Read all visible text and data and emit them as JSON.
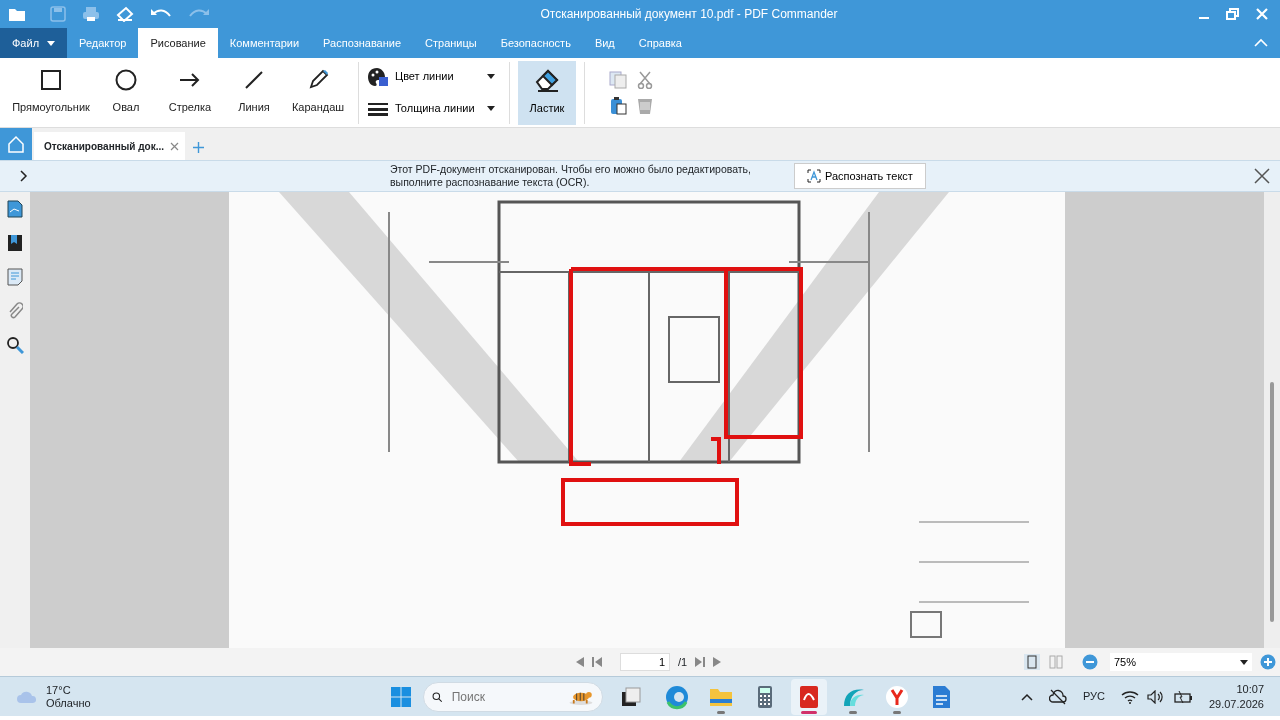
{
  "window": {
    "title": "Отсканированный документ 10.pdf - PDF Commander"
  },
  "menu": [
    {
      "label": "Файл",
      "kind": "file",
      "selected": false
    },
    {
      "label": "Редактор",
      "kind": "tab",
      "selected": false
    },
    {
      "label": "Рисование",
      "kind": "tab",
      "selected": true
    },
    {
      "label": "Комментарии",
      "kind": "tab",
      "selected": false
    },
    {
      "label": "Распознавание",
      "kind": "tab",
      "selected": false
    },
    {
      "label": "Страницы",
      "kind": "tab",
      "selected": false
    },
    {
      "label": "Безопасность",
      "kind": "tab",
      "selected": false
    },
    {
      "label": "Вид",
      "kind": "tab",
      "selected": false
    },
    {
      "label": "Справка",
      "kind": "tab",
      "selected": false
    }
  ],
  "tools": [
    {
      "label": "Прямоугольник",
      "kind": "rect"
    },
    {
      "label": "Овал",
      "kind": "oval"
    },
    {
      "label": "Стрелка",
      "kind": "arrow"
    },
    {
      "label": "Линия",
      "kind": "line"
    },
    {
      "label": "Карандаш",
      "kind": "pencil"
    }
  ],
  "line_options": [
    {
      "label": "Цвет линии",
      "kind": "color"
    },
    {
      "label": "Толщина линии",
      "kind": "width"
    }
  ],
  "eraser": {
    "label": "Ластик",
    "selected": true
  },
  "doc_tabs": [
    {
      "label": "Отсканированный док...",
      "selected": true
    }
  ],
  "ocr_bar": {
    "lines": [
      "Этот PDF-документ отсканирован. Чтобы его можно было редактировать,",
      "выполните распознавание текста (OCR)."
    ],
    "button": "Распознать текст"
  },
  "pager": {
    "page": "1",
    "total": "/1"
  },
  "zoom": {
    "value": "75%"
  },
  "taskbar": {
    "temp": "17°C",
    "weather": "Облачно",
    "search_placeholder": "Поиск",
    "lang": "РУС",
    "time": "10:07",
    "date": "29.07.2026",
    "apps": [
      {
        "kind": "explorer-task",
        "running": false,
        "selected": false
      },
      {
        "kind": "edge",
        "running": false,
        "selected": false
      },
      {
        "kind": "folder",
        "running": true,
        "selected": false
      },
      {
        "kind": "calculator",
        "running": false,
        "selected": false
      },
      {
        "kind": "pdf",
        "running": true,
        "selected": true
      },
      {
        "kind": "wave",
        "running": true,
        "selected": false
      },
      {
        "kind": "yandex",
        "running": true,
        "selected": false
      },
      {
        "kind": "docs",
        "running": false,
        "selected": false
      }
    ]
  }
}
